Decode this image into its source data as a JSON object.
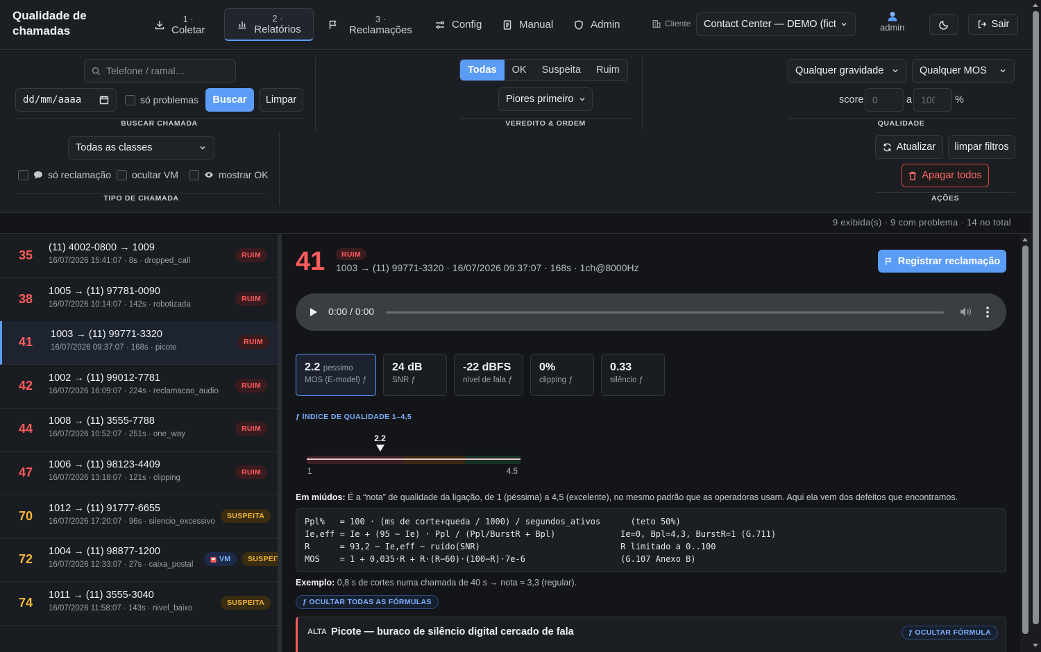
{
  "header": {
    "brand": "Qualidade de chamadas",
    "nav": [
      {
        "num": "1 ·",
        "label": "Coletar",
        "icon": "download-icon"
      },
      {
        "num": "2 ·",
        "label": "Relatórios",
        "icon": "bar-chart-icon",
        "active": true
      },
      {
        "num": "3 ·",
        "label": "Reclamações",
        "icon": "flag-icon"
      },
      {
        "label": "Config",
        "icon": "sliders-icon"
      },
      {
        "label": "Manual",
        "icon": "document-icon"
      },
      {
        "label": "Admin",
        "icon": "shield-icon"
      }
    ],
    "client_label": "Cliente",
    "client_value": "Contact Center — DEMO (fictício)",
    "user": "admin",
    "logout": "Sair"
  },
  "filters": {
    "phone_placeholder": "Telefone / ramal…",
    "date_placeholder": "dd/mm/aaaa",
    "only_problems": "só problemas",
    "search_btn": "Buscar",
    "clear_btn": "Limpar",
    "search_caption": "BUSCAR CHAMADA",
    "verdict_tabs": [
      "Todas",
      "OK",
      "Suspeita",
      "Ruim"
    ],
    "verdict_active": "Todas",
    "order": "Piores primeiro",
    "verdict_caption": "VEREDITO & ORDEM",
    "severity": "Qualquer gravidade",
    "mos": "Qualquer MOS",
    "score_label": "score",
    "score_min": "0",
    "score_to": "a",
    "score_max": "100",
    "score_unit": "%",
    "quality_caption": "QUALIDADE",
    "class_select": "Todas as classes",
    "only_complaint": "só reclamação",
    "hide_vm": "ocultar VM",
    "show_ok": "mostrar OK",
    "type_caption": "TIPO DE CHAMADA",
    "refresh_btn": "Atualizar",
    "clear_filters_btn": "limpar filtros",
    "delete_all_btn": "Apagar todos",
    "actions_caption": "AÇÕES"
  },
  "status": "9 exibida(s) · 9 com problema · 14 no total",
  "calls": [
    {
      "id": "35",
      "title": "(11) 4002-0800 → 1009",
      "meta": "16/07/2026 15:41:07 · 8s · dropped_call",
      "verdict": "RUIM"
    },
    {
      "id": "38",
      "title": "1005 → (11) 97781-0090",
      "meta": "16/07/2026 10:14:07 · 142s · robotizada",
      "verdict": "RUIM"
    },
    {
      "id": "41",
      "title": "1003 → (11) 99771-3320",
      "meta": "16/07/2026 09:37:07 · 168s · picote",
      "verdict": "RUIM",
      "selected": true
    },
    {
      "id": "42",
      "title": "1002 → (11) 99012-7781",
      "meta": "16/07/2026 16:09:07 · 224s · reclamacao_audio",
      "verdict": "RUIM"
    },
    {
      "id": "44",
      "title": "1008 → (11) 3555-7788",
      "meta": "16/07/2026 10:52:07 · 251s · one_way",
      "verdict": "RUIM"
    },
    {
      "id": "47",
      "title": "1006 → (11) 98123-4409",
      "meta": "16/07/2026 13:18:07 · 121s · clipping",
      "verdict": "RUIM"
    },
    {
      "id": "70",
      "title": "1012 → (11) 91777-6655",
      "meta": "16/07/2026 17:20:07 · 96s · silencio_excessivo",
      "verdict": "SUSPEITA"
    },
    {
      "id": "72",
      "title": "1004 → (11) 98877-1200",
      "meta": "16/07/2026 12:33:07 · 27s · caixa_postal",
      "verdict": "SUSPEITA",
      "vm": "VM"
    },
    {
      "id": "74",
      "title": "1011 → (11) 3555-3040",
      "meta": "16/07/2026 11:58:07 · 143s · nivel_baixo",
      "verdict": "SUSPEITA"
    }
  ],
  "detail": {
    "id": "41",
    "verdict": "RUIM",
    "meta": "1003 → (11) 99771-3320 · 16/07/2026 09:37:07 · 168s · 1ch@8000Hz",
    "register_btn": "Registrar reclamação",
    "player_time": "0:00 / 0:00",
    "metrics": [
      {
        "value": "2.2",
        "note": "pessimo",
        "label": "MOS (E-model) ƒ"
      },
      {
        "value": "24 dB",
        "label": "SNR ƒ"
      },
      {
        "value": "-22 dBFS",
        "label": "nível de fala ƒ"
      },
      {
        "value": "0%",
        "label": "clipping ƒ"
      },
      {
        "value": "0.33",
        "label": "silêncio ƒ"
      }
    ],
    "formula_title": "ƒ ÍNDICE DE QUALIDADE 1–4,5",
    "gauge": {
      "value": 2.2,
      "min": 1,
      "max": 4.5,
      "value_label": "2.2",
      "min_label": "1",
      "max_label": "4.5"
    },
    "explain_bold": "Em miúdos:",
    "explain_text": " É a “nota” de qualidade da ligação, de 1 (péssima) a 4,5 (excelente), no mesmo padrão que as operadoras usam. Aqui ela vem dos defeitos que encontramos.",
    "formula_code": "Ppl%   = 100 · (ms de corte+queda / 1000) / segundos_ativos      (teto 50%)\nIe,eff = Ie + (95 − Ie) · Ppl / (Ppl/BurstR + Bpl)             Ie=0, Bpl=4,3, BurstR=1 (G.711)\nR      = 93,2 − Ie,eff − ruído(SNR)                            R limitado a 0..100\nMOS    = 1 + 0,035·R + R·(R−60)·(100−R)·7e-6                   (G.107 Anexo B)",
    "example_bold": "Exemplo:",
    "example_text": " 0,8 s de cortes numa chamada de 40 s → nota ≈ 3,3 (regular).",
    "hide_all_formulas": "ƒ OCULTAR TODAS AS FÓRMULAS",
    "issue": {
      "severity": "ALTA",
      "title": "Picote — buraco de silêncio digital cercado de fala",
      "hide_formula": "ƒ OCULTAR FÓRMULA"
    }
  },
  "colors": {
    "accent": "#5b9cf6",
    "bad": "#ff5c5c",
    "warn": "#f2b53a",
    "background": "#131518"
  }
}
